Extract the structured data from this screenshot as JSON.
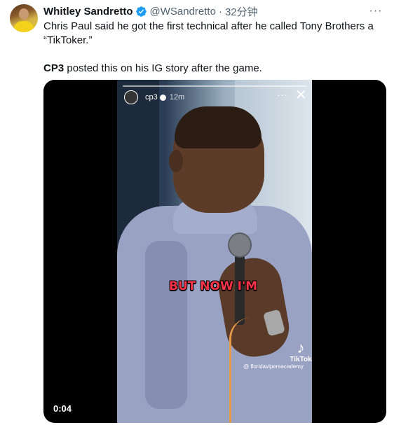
{
  "tweet": {
    "author_name": "Whitley Sandretto",
    "handle": "@WSandretto",
    "separator": "·",
    "time": "32分钟",
    "more_label": "···",
    "text_line1": "Chris Paul said he got the first technical after he called Tony Brothers a “TikToker.”",
    "text_line2_bold": "CP3",
    "text_line2_rest": " posted this on his IG story after the game."
  },
  "video": {
    "duration": "0:04",
    "story_username": "cp3",
    "story_age": "12m",
    "story_dots": "···",
    "story_close": "✕",
    "caption": "BUT NOW I'M",
    "tiktok_label": "TikTok",
    "tiktok_handle": "@ floridavipersacademy"
  },
  "colors": {
    "verified": "#1d9bf0",
    "secondary_text": "#536471",
    "caption_red": "#ff3347"
  }
}
